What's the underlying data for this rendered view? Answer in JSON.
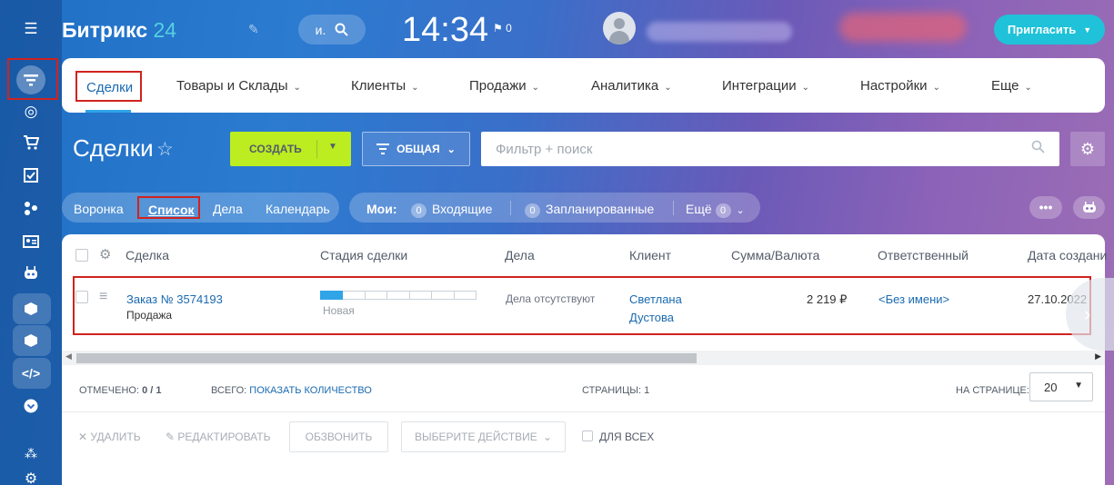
{
  "header": {
    "logo_name": "Битрикс",
    "logo_num": "24",
    "search_letter": "и.",
    "time": "14:34",
    "flag_count": "0",
    "invite_label": "Пригласить"
  },
  "menu": {
    "items": [
      {
        "label": "Сделки"
      },
      {
        "label": "Товары и Склады"
      },
      {
        "label": "Клиенты"
      },
      {
        "label": "Продажи"
      },
      {
        "label": "Аналитика"
      },
      {
        "label": "Интеграции"
      },
      {
        "label": "Настройки"
      },
      {
        "label": "Еще"
      }
    ]
  },
  "toolbar": {
    "title": "Сделки",
    "create_label": "СОЗДАТЬ",
    "filter_label": "ОБЩАЯ",
    "search_placeholder": "Фильтр + поиск"
  },
  "views": {
    "items": [
      "Воронка",
      "Список",
      "Дела",
      "Календарь"
    ]
  },
  "counters": {
    "mine_label": "Мои:",
    "incoming_count": "0",
    "incoming_label": "Входящие",
    "planned_count": "0",
    "planned_label": "Запланированные",
    "more_label": "Ещё",
    "more_count": "0"
  },
  "table": {
    "columns": [
      "Сделка",
      "Стадия сделки",
      "Дела",
      "Клиент",
      "Сумма/Валюта",
      "Ответственный",
      "Дата создани"
    ],
    "rows": [
      {
        "deal": "Заказ № 3574193",
        "deal_type": "Продажа",
        "stage": "Новая",
        "stage_progress": 0.1,
        "activities": "Дела отсутствуют",
        "client_line1": "Светлана",
        "client_line2": "Дустова",
        "amount": "2 219 ₽",
        "responsible": "<Без имени>",
        "created": "27.10.2022"
      }
    ]
  },
  "footer": {
    "checked_label": "ОТМЕЧЕНО:",
    "checked_value": "0 / 1",
    "total_label": "ВСЕГО:",
    "total_link": "ПОКАЗАТЬ КОЛИЧЕСТВО",
    "pages_label": "СТРАНИЦЫ:",
    "pages_value": "1",
    "per_page_label": "НА СТРАНИЦЕ:",
    "per_page_value": "20"
  },
  "actions": {
    "delete": "УДАЛИТЬ",
    "edit": "РЕДАКТИРОВАТЬ",
    "call": "ОБЗВОНИТЬ",
    "choose": "ВЫБЕРИТЕ ДЕЙСТВИЕ",
    "for_all": "ДЛЯ ВСЕХ"
  },
  "colors": {
    "accent": "#2fa4e7",
    "create_button": "#bbed21",
    "invite_button": "#1fc2d8",
    "highlight": "#d0231f"
  }
}
